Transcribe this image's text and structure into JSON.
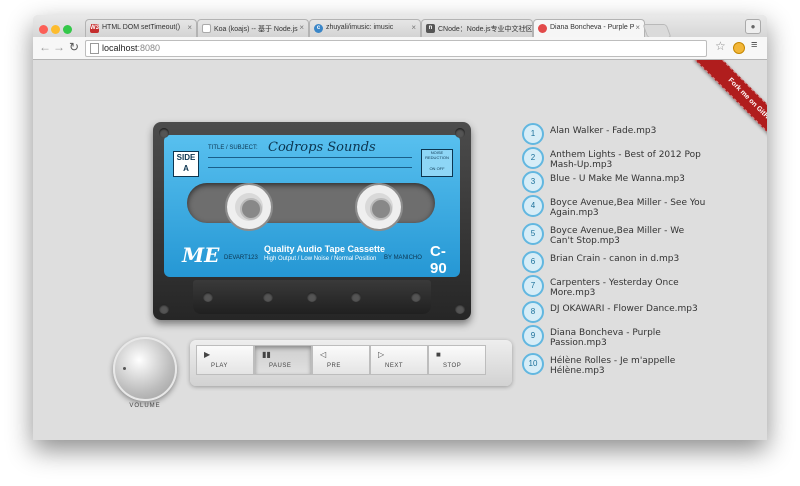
{
  "browser": {
    "tabs": [
      {
        "title": "HTML DOM setTimeout()",
        "favicon": "w3",
        "color": "#c52e2e",
        "active": false
      },
      {
        "title": "Koa (koajs) -- 基于 Node.js",
        "favicon": "doc",
        "color": "#ffffff",
        "active": false
      },
      {
        "title": "zhuyali/imusic: imusic",
        "favicon": "c",
        "color": "#3a86c8",
        "active": false
      },
      {
        "title": "CNode：Node.js专业中文社区",
        "favicon": "cn",
        "color": "#555555",
        "active": false
      },
      {
        "title": "Diana Boncheva - Purple P",
        "favicon": "record",
        "color": "#e24a4a",
        "active": true
      }
    ],
    "close_glyph": "×",
    "url_host": "localhost",
    "url_port": ":8080"
  },
  "ribbon": {
    "text": "Fork me on GitHub"
  },
  "cassette": {
    "side": "SIDE A",
    "title_caption": "TITLE / SUBJECT:",
    "title": "Codrops Sounds",
    "noise": [
      "NOISE",
      "REDUCTION",
      "ON",
      "OFF"
    ],
    "brand": "ME",
    "brand_code": "DEVART123",
    "quality": "Quality Audio Tape Cassette",
    "quality_sub": "High Output / Low Noise / Normal Position",
    "by": "BY MANICHO",
    "type": "C-90"
  },
  "volume": {
    "label": "VOLUME"
  },
  "controls": [
    {
      "icon": "▶",
      "label": "PLAY",
      "pressed": false
    },
    {
      "icon": "▮▮",
      "label": "PAUSE",
      "pressed": true
    },
    {
      "icon": "◁",
      "label": "PRE",
      "pressed": false
    },
    {
      "icon": "▷",
      "label": "NEXT",
      "pressed": false
    },
    {
      "icon": "■",
      "label": "STOP",
      "pressed": false
    }
  ],
  "playlist": [
    {
      "num": "1",
      "title": "Alan Walker - Fade.mp3"
    },
    {
      "num": "2",
      "title": "Anthem Lights - Best of 2012 Pop Mash-Up.mp3"
    },
    {
      "num": "3",
      "title": "Blue - U Make Me Wanna.mp3"
    },
    {
      "num": "4",
      "title": "Boyce Avenue,Bea Miller - See You Again.mp3"
    },
    {
      "num": "5",
      "title": "Boyce Avenue,Bea Miller - We Can't Stop.mp3"
    },
    {
      "num": "6",
      "title": "Brian Crain - canon in d.mp3"
    },
    {
      "num": "7",
      "title": "Carpenters - Yesterday Once More.mp3"
    },
    {
      "num": "8",
      "title": "DJ OKAWARI - Flower Dance.mp3"
    },
    {
      "num": "9",
      "title": "Diana Boncheva - Purple Passion.mp3"
    },
    {
      "num": "10",
      "title": "Hélène Rolles - Je m'appelle Hélène.mp3"
    }
  ]
}
